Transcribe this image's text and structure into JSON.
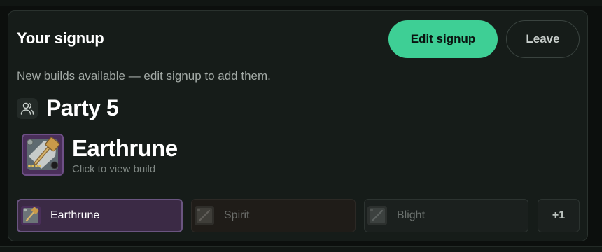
{
  "signup": {
    "title": "Your signup",
    "edit_label": "Edit signup",
    "leave_label": "Leave",
    "notice": "New builds available — edit signup to add them.",
    "party_label": "Party 5",
    "build": {
      "name": "Earthrune",
      "hint": "Click to view build"
    },
    "build_tabs": [
      {
        "label": "Earthrune",
        "selected": true
      },
      {
        "label": "Spirit",
        "selected": false
      },
      {
        "label": "Blight",
        "selected": false
      }
    ],
    "more_label": "+1"
  },
  "colors": {
    "accent": "#3ecf95",
    "selected_tab_bg": "#3b2a45",
    "card_bg": "#161c19"
  },
  "icons": {
    "party": "users-icon",
    "build": "hammer-weapon-icon"
  }
}
